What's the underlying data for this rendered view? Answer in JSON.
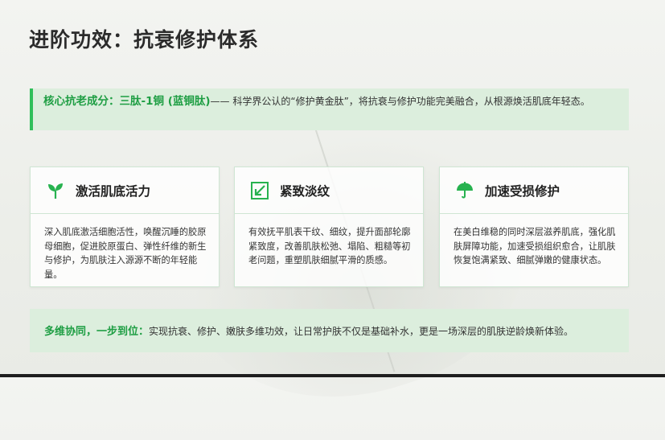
{
  "title": "进阶功效：抗衰修护体系",
  "core": {
    "highlight": "核心抗老成分：三肽-1铜 (蓝铜肽)",
    "text": "—— 科学界公认的“修护黄金肽”，将抗衰与修护功能完美融合，从根源焕活肌底年轻态。"
  },
  "cards": [
    {
      "icon": "sprout-icon",
      "title": "激活肌底活力",
      "body": "深入肌底激活细胞活性，唤醒沉睡的胶原母细胞，促进胶原蛋白、弹性纤维的新生与修护，为肌肤注入源源不断的年轻能量。"
    },
    {
      "icon": "shrink-arrow-icon",
      "title": "紧致淡纹",
      "body": "有效抚平肌表干纹、细纹，提升面部轮廓紧致度，改善肌肤松弛、塌陷、粗糙等初老问题，重塑肌肤细腻平滑的质感。"
    },
    {
      "icon": "umbrella-icon",
      "title": "加速受损修护",
      "body": "在美白维稳的同时深层滋养肌底，强化肌肤屏障功能，加速受损组织愈合，让肌肤恢复饱满紧致、细腻弹嫩的健康状态。"
    }
  ],
  "bottom": {
    "highlight": "多维协同，一步到位：",
    "text": "实现抗衰、修护、嫩肤多维功效，让日常护肤不仅是基础补水，更是一场深层的肌肤逆龄焕新体验。"
  },
  "colors": {
    "accent": "#2fbf5a",
    "accent_text": "#1e9e43",
    "panel": "#dceedd"
  }
}
